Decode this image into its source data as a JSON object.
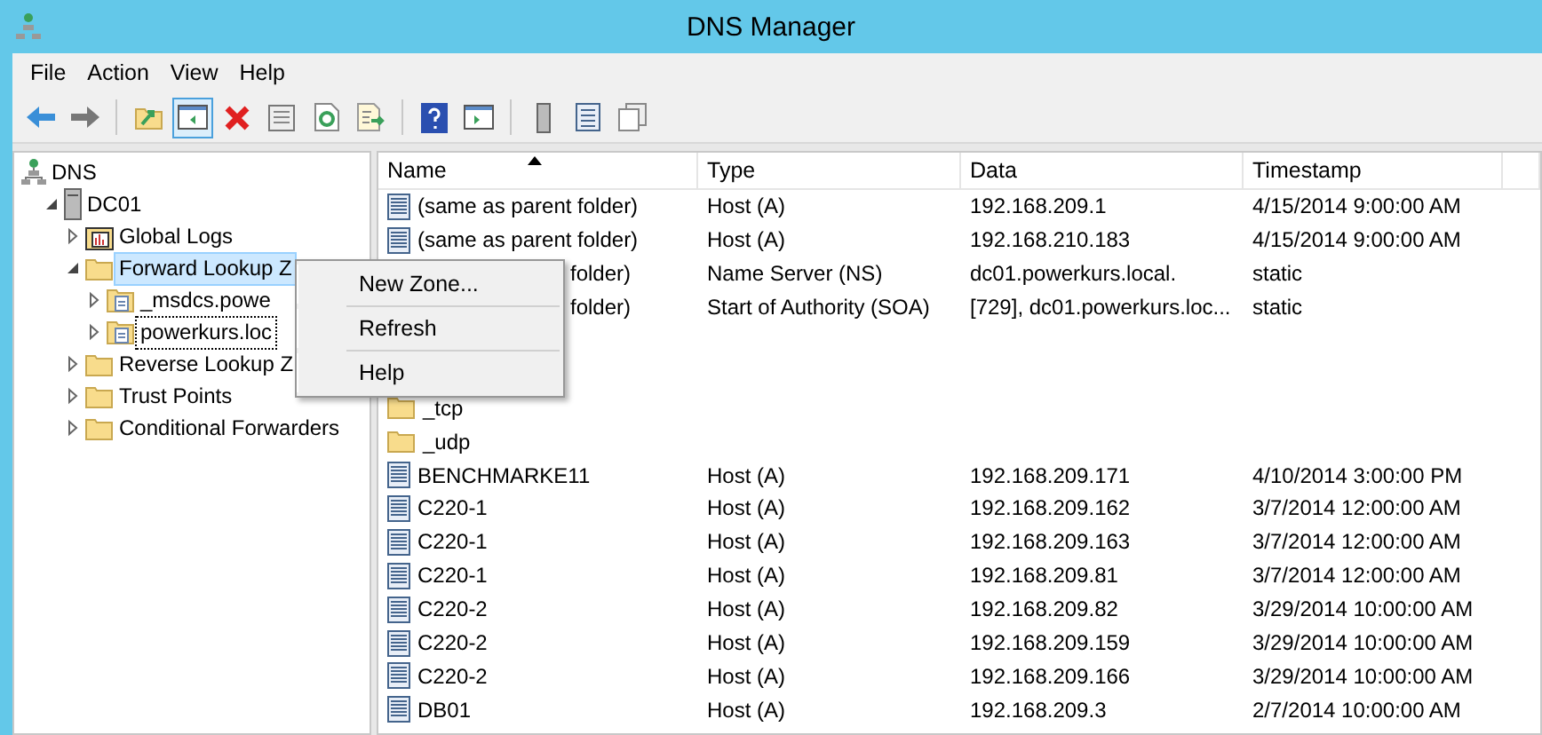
{
  "window": {
    "title": "DNS Manager"
  },
  "menu_bar": [
    "File",
    "Action",
    "View",
    "Help"
  ],
  "toolbar": [
    {
      "kind": "back",
      "selected": false
    },
    {
      "kind": "forward",
      "selected": false
    },
    {
      "kind": "sep"
    },
    {
      "kind": "up",
      "selected": false
    },
    {
      "kind": "tree",
      "selected": true
    },
    {
      "kind": "delete",
      "selected": false
    },
    {
      "kind": "properties",
      "selected": false
    },
    {
      "kind": "refresh",
      "selected": false
    },
    {
      "kind": "export",
      "selected": false
    },
    {
      "kind": "sep"
    },
    {
      "kind": "help",
      "selected": false
    },
    {
      "kind": "actionpane",
      "selected": false
    },
    {
      "kind": "sep"
    },
    {
      "kind": "server",
      "selected": false
    },
    {
      "kind": "list",
      "selected": false
    },
    {
      "kind": "copy",
      "selected": false
    }
  ],
  "tree": [
    {
      "label": "DNS",
      "kind": "dns",
      "expanded": true,
      "children": [
        {
          "label": "DC01",
          "kind": "server",
          "expanded": true,
          "children": [
            {
              "label": "Global Logs",
              "kind": "log",
              "expanded": false,
              "selected": false,
              "focused": false
            },
            {
              "label": "Forward Lookup Z",
              "kind": "folder",
              "expanded": true,
              "selected": true,
              "focused": false,
              "children": [
                {
                  "label": "_msdcs.powe",
                  "kind": "zone",
                  "expanded": false,
                  "selected": false,
                  "focused": false
                },
                {
                  "label": "powerkurs.loc",
                  "kind": "zone",
                  "expanded": false,
                  "selected": false,
                  "focused": true
                }
              ]
            },
            {
              "label": "Reverse Lookup Z",
              "kind": "folder",
              "expanded": false,
              "selected": false,
              "focused": false
            },
            {
              "label": "Trust Points",
              "kind": "folder",
              "expanded": false,
              "selected": false,
              "focused": false
            },
            {
              "label": "Conditional Forwarders",
              "kind": "folder",
              "expanded": false,
              "selected": false,
              "focused": false
            }
          ]
        }
      ]
    }
  ],
  "context_menu": [
    "New Zone...",
    "Refresh",
    "Help"
  ],
  "table": {
    "columns": [
      {
        "label": "Name",
        "sorted": true
      },
      {
        "label": "Type",
        "sorted": false
      },
      {
        "label": "Data",
        "sorted": false
      },
      {
        "label": "Timestamp",
        "sorted": false
      }
    ],
    "rows": [
      {
        "kind": "record",
        "name": "(same as parent folder)",
        "type": "Host (A)",
        "data": "192.168.209.1",
        "timestamp": "4/15/2014 9:00:00 AM"
      },
      {
        "kind": "record",
        "name": "(same as parent folder)",
        "type": "Host (A)",
        "data": "192.168.210.183",
        "timestamp": "4/15/2014 9:00:00 AM"
      },
      {
        "kind": "covered",
        "name": "folder)",
        "type": "Name Server (NS)",
        "data": "dc01.powerkurs.local.",
        "timestamp": "static"
      },
      {
        "kind": "covered",
        "name": "folder)",
        "type": "Start of Authority (SOA)",
        "data": "[729], dc01.powerkurs.loc...",
        "timestamp": "static"
      },
      {
        "kind": "hidden"
      },
      {
        "kind": "hidden"
      },
      {
        "kind": "folder",
        "name": "_tcp"
      },
      {
        "kind": "folder",
        "name": "_udp"
      },
      {
        "kind": "record",
        "name": "BENCHMARKE11",
        "type": "Host (A)",
        "data": "192.168.209.171",
        "timestamp": "4/10/2014 3:00:00 PM"
      },
      {
        "kind": "record",
        "name": "C220-1",
        "type": "Host (A)",
        "data": "192.168.209.162",
        "timestamp": "3/7/2014 12:00:00 AM"
      },
      {
        "kind": "record",
        "name": "C220-1",
        "type": "Host (A)",
        "data": "192.168.209.163",
        "timestamp": "3/7/2014 12:00:00 AM"
      },
      {
        "kind": "record",
        "name": "C220-1",
        "type": "Host (A)",
        "data": "192.168.209.81",
        "timestamp": "3/7/2014 12:00:00 AM"
      },
      {
        "kind": "record",
        "name": "C220-2",
        "type": "Host (A)",
        "data": "192.168.209.82",
        "timestamp": "3/29/2014 10:00:00 AM"
      },
      {
        "kind": "record",
        "name": "C220-2",
        "type": "Host (A)",
        "data": "192.168.209.159",
        "timestamp": "3/29/2014 10:00:00 AM"
      },
      {
        "kind": "record",
        "name": "C220-2",
        "type": "Host (A)",
        "data": "192.168.209.166",
        "timestamp": "3/29/2014 10:00:00 AM"
      },
      {
        "kind": "record",
        "name": "DB01",
        "type": "Host (A)",
        "data": "192.168.209.3",
        "timestamp": "2/7/2014 10:00:00 AM"
      }
    ]
  }
}
